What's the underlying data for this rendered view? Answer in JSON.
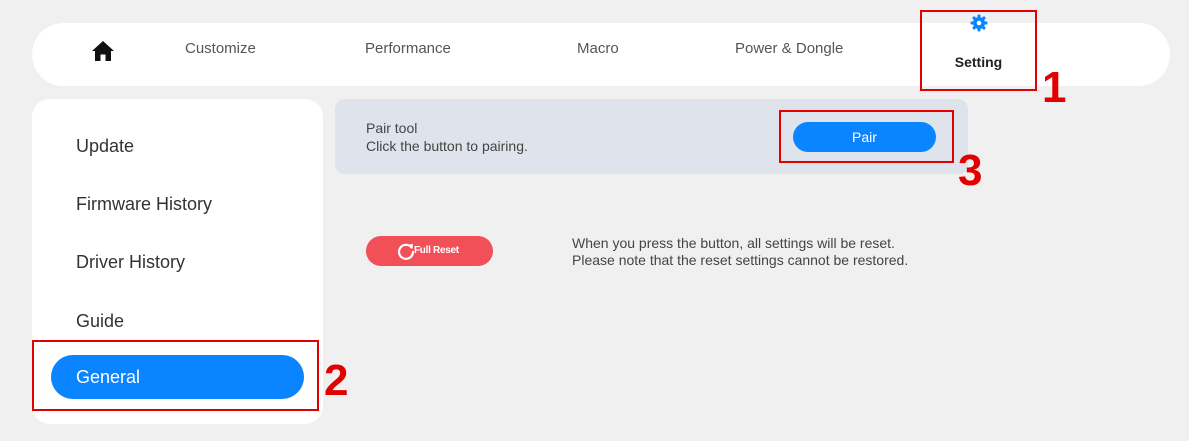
{
  "nav": {
    "items": [
      {
        "label": "Customize"
      },
      {
        "label": "Performance"
      },
      {
        "label": "Macro"
      },
      {
        "label": "Power & Dongle"
      }
    ],
    "active_label": "Setting",
    "home_icon": "home-icon",
    "active_icon": "gear-icon"
  },
  "sidebar": {
    "items": [
      {
        "label": "Update"
      },
      {
        "label": "Firmware History"
      },
      {
        "label": "Driver History"
      },
      {
        "label": "Guide"
      }
    ],
    "active_label": "General"
  },
  "pair": {
    "title": "Pair tool",
    "description": "Click the button to pairing.",
    "button_label": "Pair"
  },
  "reset": {
    "button_label": "Full Reset",
    "icon": "refresh-icon",
    "note_line1": "When you press the button, all settings will be reset.",
    "note_line2": "Please note that the reset settings cannot be restored."
  },
  "annotations": {
    "markers": [
      "1",
      "2",
      "3"
    ],
    "color": "#e30000"
  },
  "colors": {
    "accent": "#0a84ff",
    "danger": "#f25059",
    "panel": "#dfe4ec"
  }
}
